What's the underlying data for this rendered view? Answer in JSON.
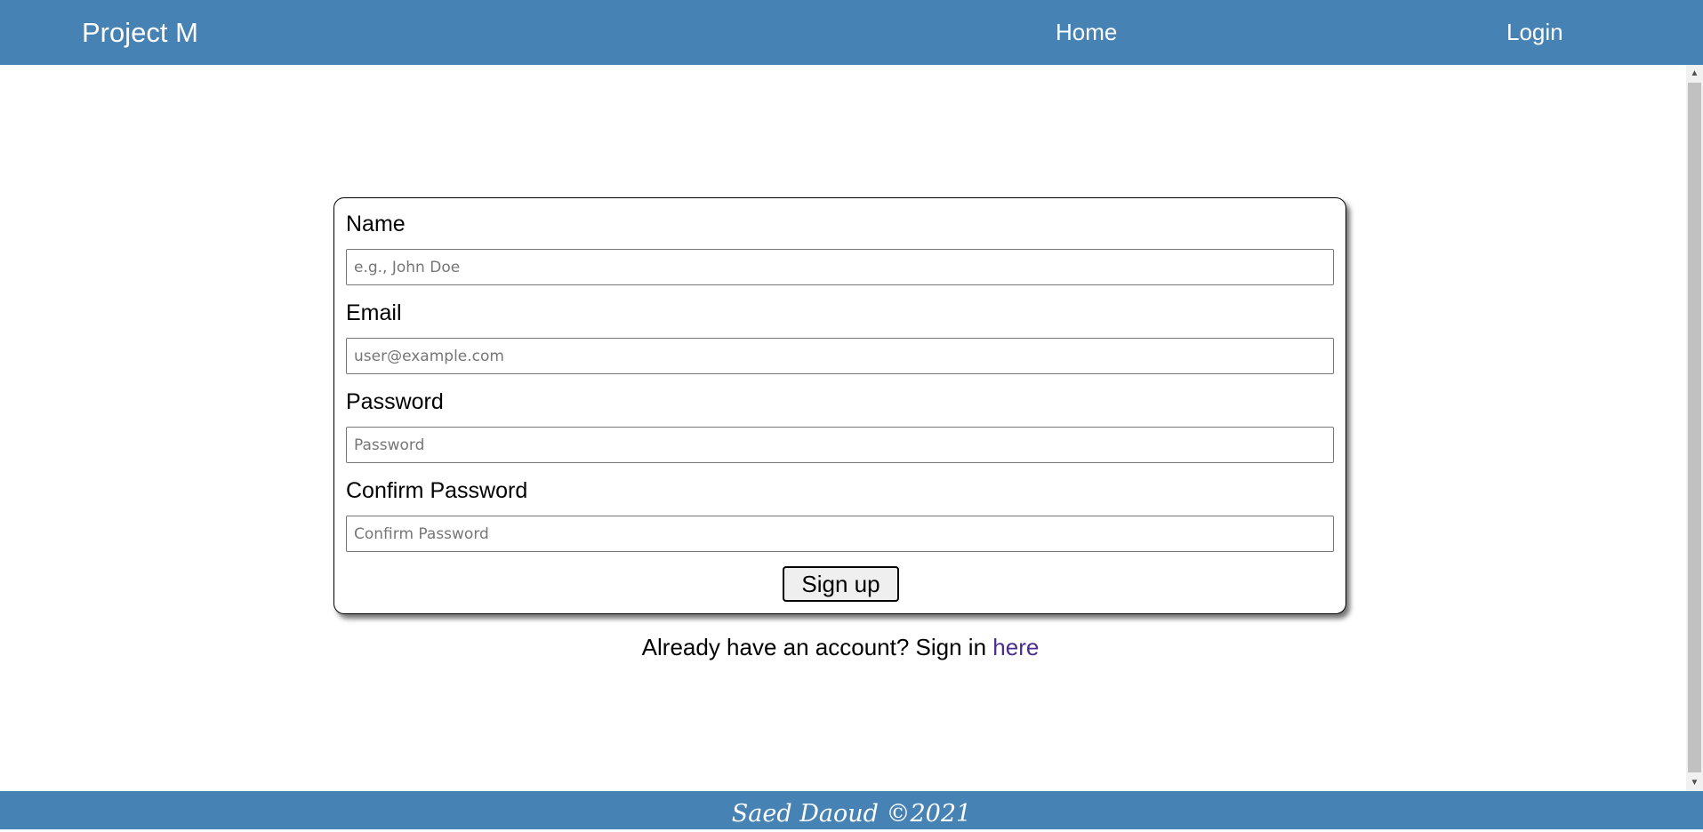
{
  "navbar": {
    "brand": "Project M",
    "links": {
      "home": "Home",
      "login": "Login"
    }
  },
  "form": {
    "name": {
      "label": "Name",
      "placeholder": "e.g., John Doe",
      "value": ""
    },
    "email": {
      "label": "Email",
      "placeholder": "user@example.com",
      "value": ""
    },
    "password": {
      "label": "Password",
      "placeholder": "Password",
      "value": ""
    },
    "confirm_password": {
      "label": "Confirm Password",
      "placeholder": "Confirm Password",
      "value": ""
    },
    "submit_label": "Sign up"
  },
  "signin": {
    "prompt": "Already have an account? Sign in ",
    "link_text": "here"
  },
  "footer": {
    "text": "Saed Daoud ©2021"
  },
  "colors": {
    "navbar_bg": "#4682b4",
    "link_visited": "#4b2c8f"
  }
}
